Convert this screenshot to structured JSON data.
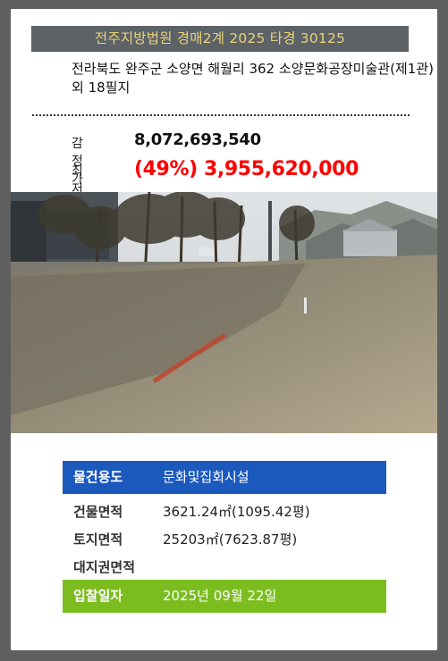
{
  "case_title": "전주지방법원 경매2계 2025 타경 30125",
  "address": "전라북도 완주군 소양면 해월리 362 소양문화공장미술관(제1관)외 18필지",
  "prices": {
    "appraised_label": "감정가",
    "appraised_value": "8,072,693,540",
    "minimum_label": "최저가",
    "minimum_value": "(49%) 3,955,620,000"
  },
  "details": {
    "usage_label": "물건용도",
    "usage_value": "문화및집회시설",
    "building_area_label": "건물면적",
    "building_area_value": "3621.24㎡(1095.42평)",
    "land_area_label": "토지면적",
    "land_area_value": "25203㎡(7623.87평)",
    "land_rights_label": "대지권면적",
    "land_rights_value": "",
    "bid_date_label": "입찰일자",
    "bid_date_value": "2025년 09월 22일"
  },
  "colors": {
    "banner_bg": "#5d6266",
    "banner_text": "#e8d27a",
    "min_price": "#ff0000",
    "usage_bar": "#1c59bd",
    "bid_bar": "#7bbd1f"
  },
  "photo_subject": "property-photo-field-with-trees"
}
